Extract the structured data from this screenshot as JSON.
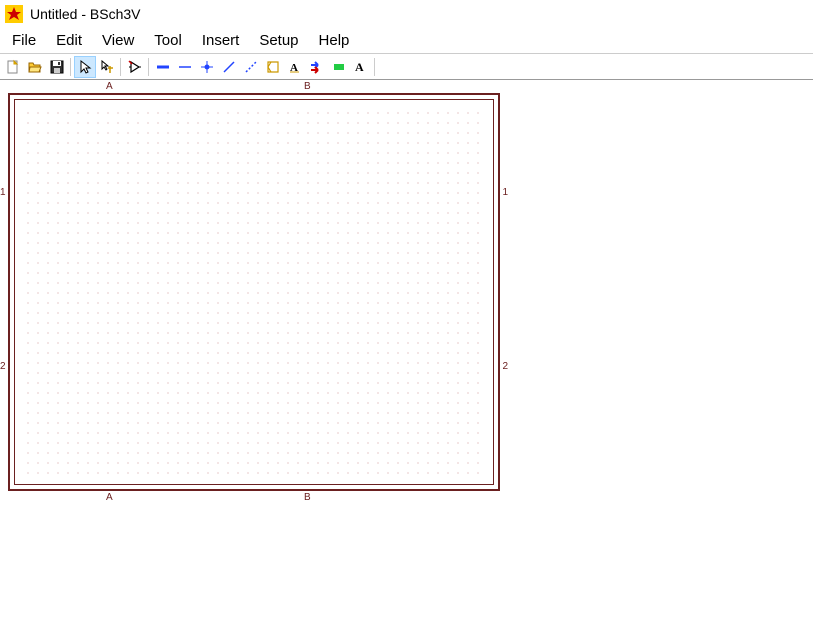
{
  "titlebar": {
    "title": "Untitled - BSch3V"
  },
  "menubar": {
    "items": [
      "File",
      "Edit",
      "View",
      "Tool",
      "Insert",
      "Setup",
      "Help"
    ]
  },
  "toolbar": {
    "groups": [
      [
        "new",
        "open",
        "save"
      ],
      [
        "selector",
        "drag"
      ],
      [
        "component"
      ],
      [
        "bus",
        "wire",
        "junction",
        "line",
        "dash",
        "marker-origin",
        "label",
        "bus-entry",
        "tag",
        "text"
      ]
    ]
  },
  "frame": {
    "top_labels": [
      "A",
      "B"
    ],
    "bottom_labels": [
      "A",
      "B"
    ],
    "left_labels": [
      "1",
      "2"
    ],
    "right_labels": [
      "1",
      "2"
    ]
  }
}
